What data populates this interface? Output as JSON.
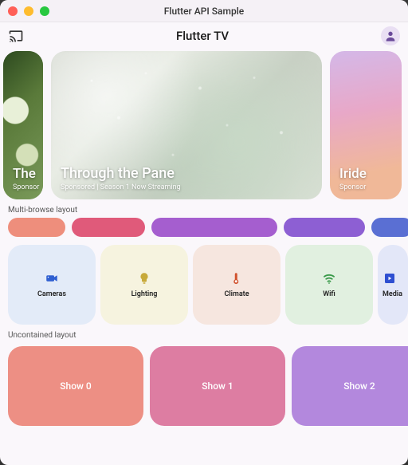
{
  "window": {
    "title": "Flutter API Sample"
  },
  "appbar": {
    "title": "Flutter TV"
  },
  "hero": {
    "left": {
      "title": "The",
      "sub": "Sponsor"
    },
    "main": {
      "title": "Through the Pane",
      "sub": "Sponsored | Season 1 Now Streaming"
    },
    "right": {
      "title": "Iride",
      "sub": "Sponsor"
    }
  },
  "sections": {
    "multi_browse": {
      "label": "Multi-browse layout",
      "pills": [
        {
          "color": "#ee8e7c",
          "w": 72
        },
        {
          "color": "#e05a7a",
          "w": 92
        },
        {
          "color": "#a55ecf",
          "w": 158
        },
        {
          "color": "#8d5fd3",
          "w": 102
        },
        {
          "color": "#5a6fd3",
          "w": 52
        }
      ],
      "tiles": [
        {
          "name": "Cameras",
          "icon": "camera-icon",
          "bg": "#e3ebf8",
          "fg": "#2f5fd1"
        },
        {
          "name": "Lighting",
          "icon": "lightbulb-icon",
          "bg": "#f6f3df",
          "fg": "#c7a93a"
        },
        {
          "name": "Climate",
          "icon": "thermo-icon",
          "bg": "#f6e6df",
          "fg": "#d1532f"
        },
        {
          "name": "Wifi",
          "icon": "wifi-icon",
          "bg": "#e1f0e0",
          "fg": "#3a9a4a"
        },
        {
          "name": "Media",
          "icon": "media-icon",
          "bg": "#e3e7f8",
          "fg": "#2f4fd1"
        }
      ]
    },
    "uncontained": {
      "label": "Uncontained layout",
      "shows": [
        {
          "label": "Show 0",
          "bg": "#ed8f84",
          "w": 170
        },
        {
          "label": "Show 1",
          "bg": "#dd7da2",
          "w": 170
        },
        {
          "label": "Show 2",
          "bg": "#b賞88dd",
          "w": 170
        }
      ]
    }
  }
}
